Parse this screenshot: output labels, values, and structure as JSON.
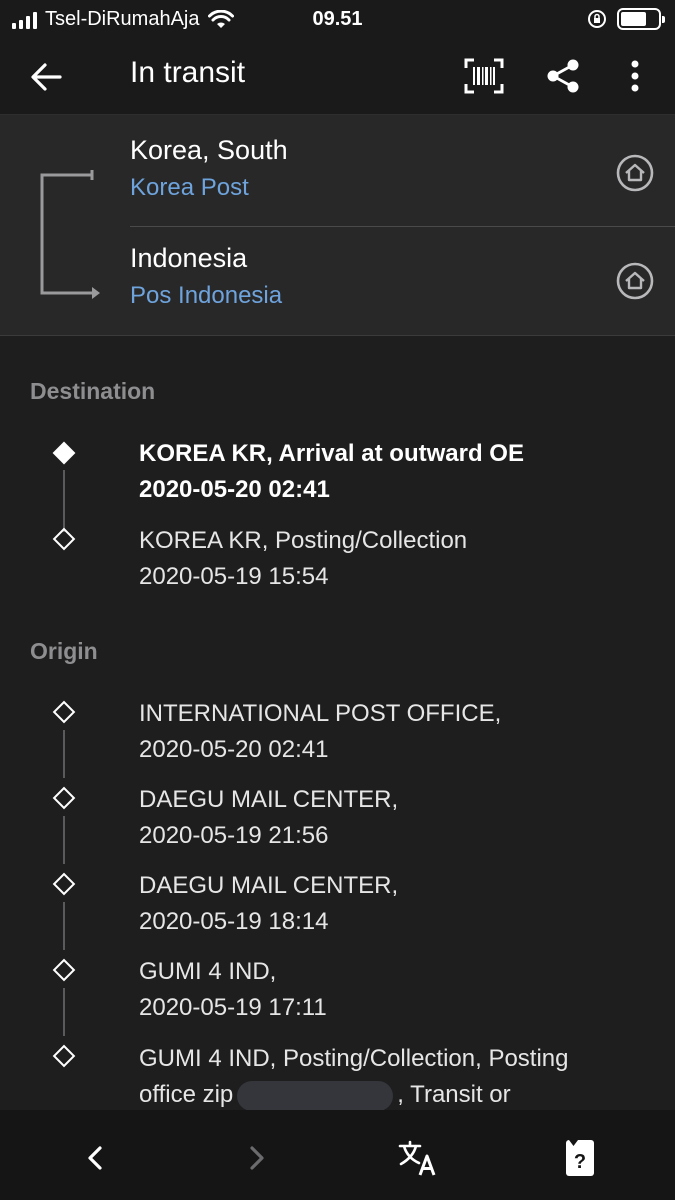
{
  "status_bar": {
    "carrier": "Tsel-DiRumahAja",
    "time": "09.51",
    "battery_level": 0.7
  },
  "toolbar": {
    "title": "In transit",
    "icons": [
      "back-arrow-icon",
      "barcode-scan-icon",
      "share-icon",
      "more-vertical-icon"
    ]
  },
  "route": {
    "origin": {
      "country": "Korea, South",
      "carrier": "Korea Post"
    },
    "destination": {
      "country": "Indonesia",
      "carrier": "Pos Indonesia"
    }
  },
  "destination_section": {
    "title": "Destination",
    "events": [
      {
        "line1": "KOREA KR, Arrival at outward OE",
        "line2": "2020-05-20 02:41",
        "latest": true
      },
      {
        "line1": "KOREA KR, Posting/Collection",
        "line2": "2020-05-19 15:54",
        "latest": false
      }
    ]
  },
  "origin_section": {
    "title": "Origin",
    "events": [
      {
        "line1": "INTERNATIONAL POST OFFICE,",
        "line2": "2020-05-20 02:41"
      },
      {
        "line1": "DAEGU MAIL CENTER,",
        "line2": "2020-05-19 21:56"
      },
      {
        "line1": "DAEGU MAIL CENTER,",
        "line2": "2020-05-19 18:14"
      },
      {
        "line1": "GUMI 4 IND,",
        "line2": "2020-05-19 17:11"
      },
      {
        "line1": "GUMI 4 IND, Posting/Collection, Posting",
        "line2a": "office zip",
        "line2b": ", Transit or"
      }
    ]
  },
  "colors": {
    "background": "#1e1e1f",
    "card": "#282829",
    "accent_link": "#6ea3dc",
    "muted_text": "#8e8e90"
  },
  "bottom_bar": {
    "icons": [
      "chevron-left-icon",
      "chevron-right-icon",
      "translate-icon",
      "help-card-icon"
    ],
    "help_symbol": "?"
  }
}
